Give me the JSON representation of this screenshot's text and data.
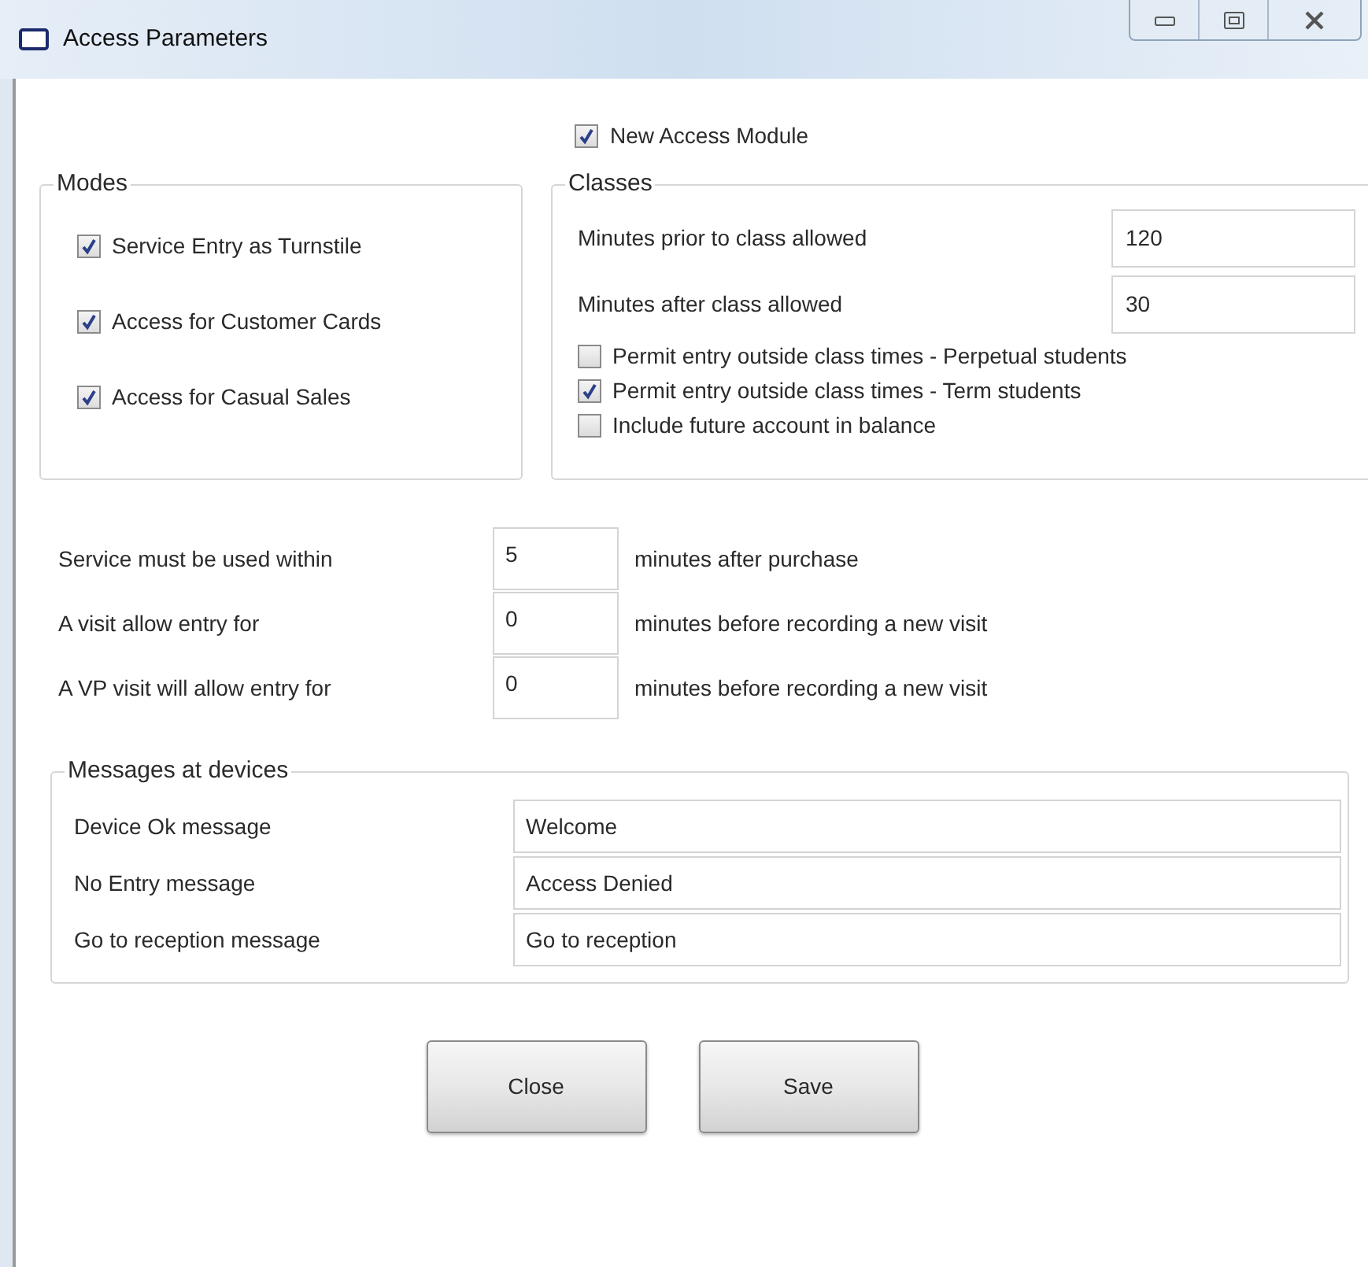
{
  "window": {
    "title": "Access Parameters"
  },
  "new_access_module": {
    "label": "New Access Module",
    "checked": true
  },
  "modes": {
    "title": "Modes",
    "options": [
      {
        "label": "Service Entry as Turnstile",
        "checked": true
      },
      {
        "label": "Access for Customer Cards",
        "checked": true
      },
      {
        "label": "Access for Casual Sales",
        "checked": true
      }
    ]
  },
  "classes": {
    "title": "Classes",
    "fields": [
      {
        "label": "Minutes prior to class allowed",
        "value": "120"
      },
      {
        "label": "Minutes after class allowed",
        "value": "30"
      }
    ],
    "options": [
      {
        "label": "Permit entry outside class times - Perpetual students",
        "checked": false
      },
      {
        "label": "Permit entry outside class times - Term students",
        "checked": true
      },
      {
        "label": "Include future account in balance",
        "checked": false
      }
    ]
  },
  "timings": [
    {
      "label": "Service must be used within",
      "value": "5",
      "suffix": "minutes after purchase"
    },
    {
      "label": "A visit allow entry for",
      "value": "0",
      "suffix": "minutes before recording a new visit"
    },
    {
      "label": "A VP visit will allow entry for",
      "value": "0",
      "suffix": "minutes before recording a new visit"
    }
  ],
  "messages": {
    "title": "Messages at devices",
    "fields": [
      {
        "label": "Device Ok message",
        "value": "Welcome"
      },
      {
        "label": "No Entry message",
        "value": "Access Denied"
      },
      {
        "label": "Go to reception message",
        "value": "Go to reception"
      }
    ]
  },
  "buttons": [
    "Close",
    "Save"
  ]
}
